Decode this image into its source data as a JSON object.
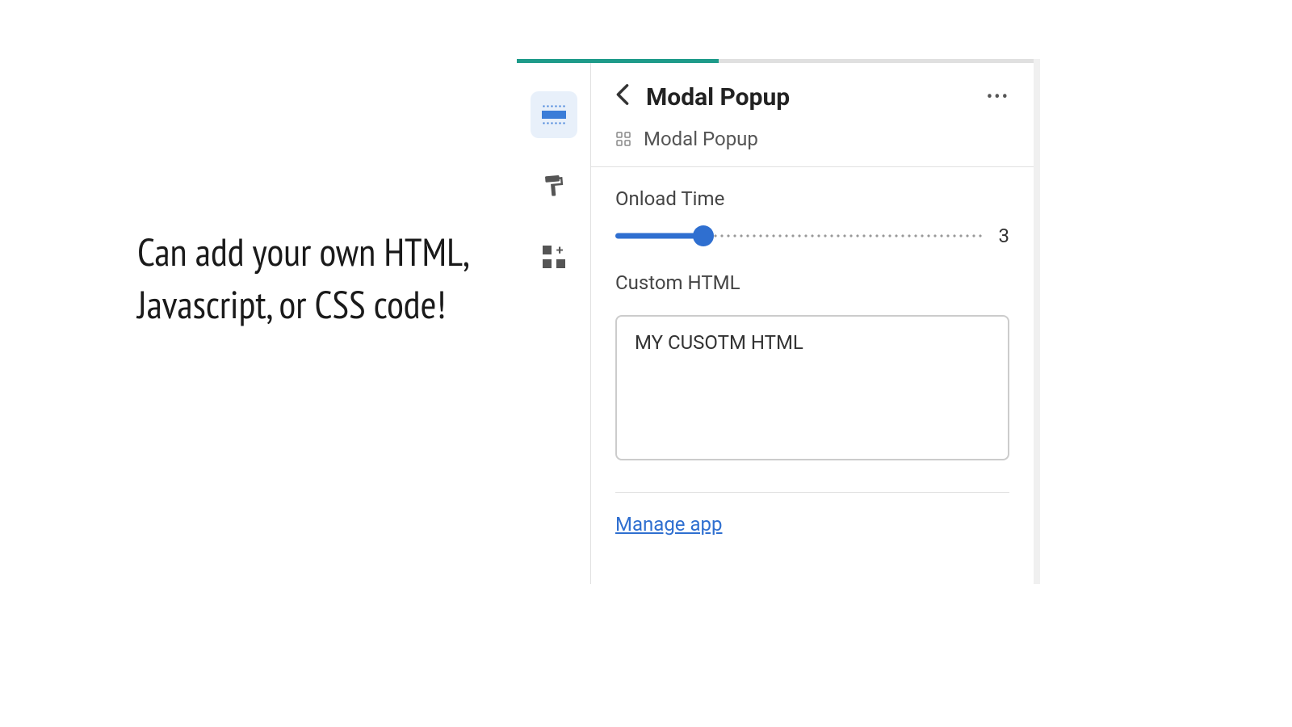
{
  "caption": "Can add your own HTML, Javascript, or CSS code!",
  "progress": {
    "percent": 39
  },
  "header": {
    "title": "Modal Popup",
    "breadcrumb": "Modal Popup"
  },
  "fields": {
    "onload": {
      "label": "Onload Time",
      "value": "3",
      "min": 0,
      "max": 12
    },
    "custom_html": {
      "label": "Custom HTML",
      "value": "MY CUSOTM HTML"
    }
  },
  "footer": {
    "manage_link": "Manage app"
  }
}
